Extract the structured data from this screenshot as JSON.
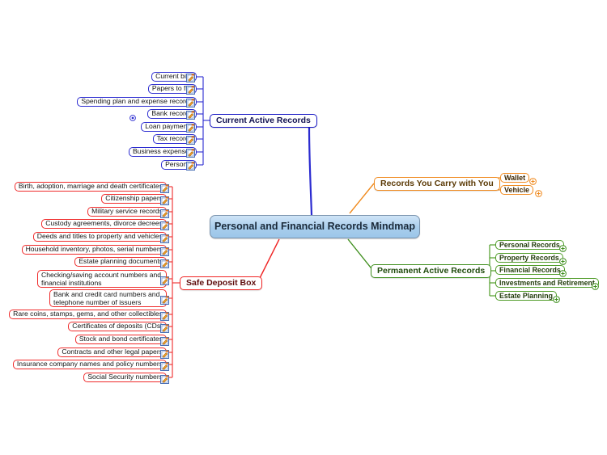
{
  "map": {
    "title": "Personal and Financial Records Mindmap",
    "background": "#ffffff",
    "colors": {
      "center_fill": "#a8cdec",
      "center_border": "#7a93ad",
      "branch_blue": "#1717c4",
      "branch_orange": "#f08a1e",
      "branch_red": "#f02525",
      "branch_green": "#3f8f1e"
    }
  },
  "branches": {
    "current_active_records": {
      "label": "Current Active Records",
      "color": "#1717c4",
      "children": [
        {
          "label": "Current bills",
          "note_icon": "note-edit-icon"
        },
        {
          "label": "Papers to file",
          "note_icon": "note-edit-icon"
        },
        {
          "label": "Spending plan and expense records",
          "note_icon": "note-edit-icon"
        },
        {
          "label": "Bank records",
          "note_icon": "note-edit-icon",
          "collapse_icon": "collapse-toggle-icon"
        },
        {
          "label": "Loan payments",
          "note_icon": "note-edit-icon"
        },
        {
          "label": "Tax records",
          "note_icon": "note-edit-icon"
        },
        {
          "label": "Business expenses",
          "note_icon": "note-edit-icon"
        },
        {
          "label": "Personal",
          "note_icon": "note-edit-icon"
        }
      ]
    },
    "records_you_carry_with_you": {
      "label": "Records You Carry with You",
      "color": "#f08a1e",
      "children": [
        {
          "label": "Wallet",
          "expand_icon": "plus-expand-icon"
        },
        {
          "label": "Vehicle",
          "expand_icon": "plus-expand-icon"
        }
      ]
    },
    "safe_deposit_box": {
      "label": "Safe Deposit Box",
      "color": "#f02525",
      "children": [
        {
          "label": "Birth, adoption, marriage and death certificates",
          "note_icon": "note-edit-icon"
        },
        {
          "label": "Citizenship papers",
          "note_icon": "note-edit-icon"
        },
        {
          "label": "Military service records",
          "note_icon": "note-edit-icon"
        },
        {
          "label": "Custody agreements, divorce decrees",
          "note_icon": "note-edit-icon"
        },
        {
          "label": "Deeds and titles to property and vehicles",
          "note_icon": "note-edit-icon"
        },
        {
          "label": "Household inventory, photos, serial numbers",
          "note_icon": "note-edit-icon"
        },
        {
          "label": "Estate planning documents",
          "note_icon": "note-edit-icon"
        },
        {
          "label": "Checking/saving account numbers and financial institutions",
          "note_icon": "note-edit-icon"
        },
        {
          "label": "Bank and credit card numbers and telephone number of issuers",
          "note_icon": "note-edit-icon"
        },
        {
          "label": "Rare coins, stamps, gems, and other collectibles",
          "note_icon": "note-edit-icon"
        },
        {
          "label": "Certificates of deposits (CDs)",
          "note_icon": "note-edit-icon"
        },
        {
          "label": "Stock and bond certificates",
          "note_icon": "note-edit-icon"
        },
        {
          "label": "Contracts and other legal papers",
          "note_icon": "note-edit-icon"
        },
        {
          "label": "Insurance company names and policy numbers",
          "note_icon": "note-edit-icon"
        },
        {
          "label": "Social Security numbers",
          "note_icon": "note-edit-icon"
        }
      ]
    },
    "permanent_active_records": {
      "label": "Permanent Active Records",
      "color": "#3f8f1e",
      "children": [
        {
          "label": "Personal Records",
          "expand_icon": "plus-expand-icon"
        },
        {
          "label": "Property Records",
          "expand_icon": "plus-expand-icon"
        },
        {
          "label": "Financial Records",
          "expand_icon": "plus-expand-icon"
        },
        {
          "label": "Investments and Retirement",
          "expand_icon": "plus-expand-icon"
        },
        {
          "label": "Estate Planning",
          "expand_icon": "plus-expand-icon"
        }
      ]
    }
  }
}
